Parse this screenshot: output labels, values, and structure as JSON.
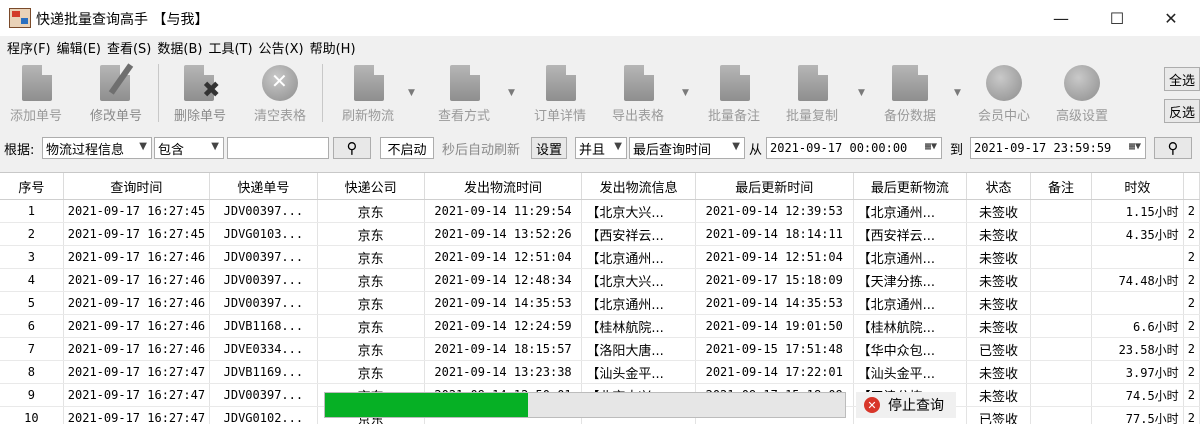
{
  "window": {
    "title": "快递批量查询高手 【与我】",
    "minimize": "—",
    "maximize": "☐",
    "close": "✕"
  },
  "menu": [
    "程序(F)",
    "编辑(E)",
    "查看(S)",
    "数据(B)",
    "工具(T)",
    "公告(X)",
    "帮助(H)"
  ],
  "toolbar": {
    "add": "添加单号",
    "edit": "修改单号",
    "delete": "删除单号",
    "clear": "清空表格",
    "refresh": "刷新物流",
    "view_mode": "查看方式",
    "order_detail": "订单详情",
    "export": "导出表格",
    "batch_note": "批量备注",
    "batch_copy": "批量复制",
    "backup": "备份数据",
    "member": "会员中心",
    "advanced": "高级设置",
    "select_all": "全选",
    "invert": "反选"
  },
  "filter": {
    "basis_label": "根据:",
    "basis_value": "物流过程信息",
    "contain_value": "包含",
    "keyword": "",
    "auto_state": "不启动",
    "auto_text": "秒后自动刷新",
    "settings": "设置",
    "logic": "并且",
    "time_field": "最后查询时间",
    "from_label": "从",
    "from_value": "2021-09-17 00:00:00",
    "to_label": "到",
    "to_value": "2021-09-17 23:59:59"
  },
  "table": {
    "columns": [
      "序号",
      "查询时间",
      "快递单号",
      "快递公司",
      "发出物流时间",
      "发出物流信息",
      "最后更新时间",
      "最后更新物流",
      "状态",
      "备注",
      "时效",
      ""
    ],
    "rows": [
      [
        "1",
        "2021-09-17 16:27:45",
        "JDV00397...",
        "京东",
        "2021-09-14 11:29:54",
        "【北京大兴...",
        "2021-09-14 12:39:53",
        "【北京通州...",
        "未签收",
        "",
        "1.15小时",
        "2"
      ],
      [
        "2",
        "2021-09-17 16:27:45",
        "JDVG0103...",
        "京东",
        "2021-09-14 13:52:26",
        "【西安祥云...",
        "2021-09-14 18:14:11",
        "【西安祥云...",
        "未签收",
        "",
        "4.35小时",
        "2"
      ],
      [
        "3",
        "2021-09-17 16:27:46",
        "JDV00397...",
        "京东",
        "2021-09-14 12:51:04",
        "【北京通州...",
        "2021-09-14 12:51:04",
        "【北京通州...",
        "未签收",
        "",
        "",
        "2"
      ],
      [
        "4",
        "2021-09-17 16:27:46",
        "JDV00397...",
        "京东",
        "2021-09-14 12:48:34",
        "【北京大兴...",
        "2021-09-17 15:18:09",
        "【天津分拣...",
        "未签收",
        "",
        "74.48小时",
        "2"
      ],
      [
        "5",
        "2021-09-17 16:27:46",
        "JDV00397...",
        "京东",
        "2021-09-14 14:35:53",
        "【北京通州...",
        "2021-09-14 14:35:53",
        "【北京通州...",
        "未签收",
        "",
        "",
        "2"
      ],
      [
        "6",
        "2021-09-17 16:27:46",
        "JDVB1168...",
        "京东",
        "2021-09-14 12:24:59",
        "【桂林航院...",
        "2021-09-14 19:01:50",
        "【桂林航院...",
        "未签收",
        "",
        "6.6小时",
        "2"
      ],
      [
        "7",
        "2021-09-17 16:27:46",
        "JDVE0334...",
        "京东",
        "2021-09-14 18:15:57",
        "【洛阳大唐...",
        "2021-09-15 17:51:48",
        "【华中众包...",
        "已签收",
        "",
        "23.58小时",
        "2"
      ],
      [
        "8",
        "2021-09-17 16:27:47",
        "JDVB1169...",
        "京东",
        "2021-09-14 13:23:38",
        "【汕头金平...",
        "2021-09-14 17:22:01",
        "【汕头金平...",
        "未签收",
        "",
        "3.97小时",
        "2"
      ],
      [
        "9",
        "2021-09-17 16:27:47",
        "JDV00397...",
        "京东",
        "2021-09-14 12:50:01",
        "【北京大兴...",
        "2021-09-17 15:18:09",
        "【天津分拣...",
        "未签收",
        "",
        "74.5小时",
        "2"
      ],
      [
        "10",
        "2021-09-17 16:27:47",
        "JDVG0102...",
        "京东",
        "",
        "",
        "",
        "",
        "已签收",
        "",
        "77.5小时",
        "2"
      ]
    ]
  },
  "status": {
    "progress": 0.39,
    "stop_label": "停止查询"
  }
}
